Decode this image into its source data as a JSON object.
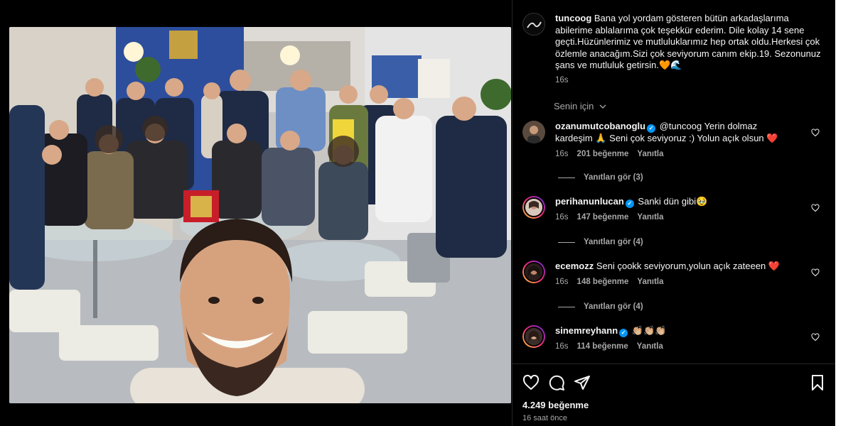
{
  "post": {
    "photo_alt": "photo",
    "caption": {
      "username": "tuncoog",
      "text": "Bana yol yordam gösteren bütün arkadaşlarıma abilerime ablalarıma çok teşekkür ederim. Dile kolay 14 sene geçti.Hüzünlerimiz ve mutluluklarımız hep ortak oldu.Herkesi çok özlemle anacağım.Sizi çok seviyorum canım ekip.19. Sezonunuz şans ve mutluluk getirsin.🧡🌊",
      "time": "16s"
    },
    "translate_label": "Senin için",
    "comments": [
      {
        "username": "ozanumutcobanoglu",
        "verified": true,
        "text": "@tuncoog Yerin dolmaz kardeşim 🙏 Seni çok seviyoruz :) Yolun açık olsun ❤️",
        "time": "16s",
        "likes": "201 beğenme",
        "reply": "Yanıtla",
        "view_replies": "Yanıtları gör (3)"
      },
      {
        "username": "perihanunlucan",
        "verified": true,
        "text": "Sanki dün gibi🥹",
        "time": "16s",
        "likes": "147 beğenme",
        "reply": "Yanıtla",
        "view_replies": "Yanıtları gör (4)"
      },
      {
        "username": "ecemozz",
        "verified": false,
        "text": "Seni çookk seviyorum,yolun açık zateeen ❤️",
        "time": "16s",
        "likes": "148 beğenme",
        "reply": "Yanıtla",
        "view_replies": "Yanıtları gör (4)"
      },
      {
        "username": "sinemreyhann",
        "verified": true,
        "text": "👏🏼👏🏼👏🏼",
        "time": "16s",
        "likes": "114 beğenme",
        "reply": "Yanıtla"
      }
    ],
    "total_likes": "4.249 beğenme",
    "posted_ago": "16 saat önce"
  },
  "icons": {
    "like": "heart-icon",
    "comment": "comment-icon",
    "share": "share-icon",
    "save": "bookmark-icon",
    "comment_like": "heart-icon",
    "verified": "verified-badge-icon"
  },
  "colors": {
    "background": "#000000",
    "text": "#f5f5f5",
    "secondary": "#a8a8a8",
    "verified": "#0095f6"
  }
}
